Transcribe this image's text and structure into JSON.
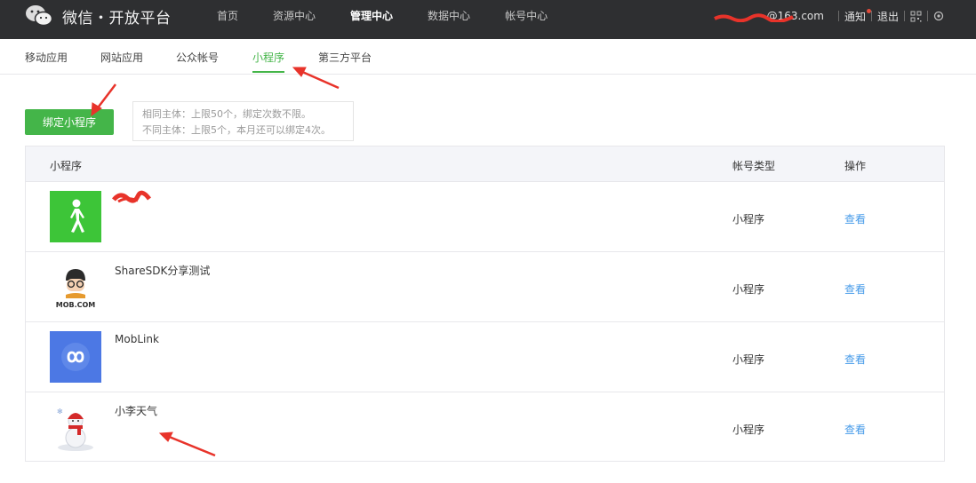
{
  "header": {
    "brand": "微信・开放平台",
    "nav": [
      {
        "label": "首页",
        "active": false
      },
      {
        "label": "资源中心",
        "active": false
      },
      {
        "label": "管理中心",
        "active": true
      },
      {
        "label": "数据中心",
        "active": false
      },
      {
        "label": "帐号中心",
        "active": false
      }
    ],
    "account_email_suffix": "@163.com",
    "notice": "通知",
    "logout": "退出"
  },
  "subtabs": [
    {
      "label": "移动应用",
      "active": false
    },
    {
      "label": "网站应用",
      "active": false
    },
    {
      "label": "公众帐号",
      "active": false
    },
    {
      "label": "小程序",
      "active": true
    },
    {
      "label": "第三方平台",
      "active": false
    }
  ],
  "bind_button": "绑定小程序",
  "tip": {
    "line1": "相同主体：上限50个，绑定次数不限。",
    "line2": "不同主体：上限5个，本月还可以绑定4次。"
  },
  "table": {
    "headers": {
      "name": "小程序",
      "type": "帐号类型",
      "action": "操作"
    },
    "rows": [
      {
        "name": "",
        "type": "小程序",
        "action": "查看",
        "icon": "walking-person-icon"
      },
      {
        "name": "ShareSDK分享测试",
        "type": "小程序",
        "action": "查看",
        "icon": "mob-logo-icon"
      },
      {
        "name": "MobLink",
        "type": "小程序",
        "action": "查看",
        "icon": "moblink-infinity-icon"
      },
      {
        "name": "小李天气",
        "type": "小程序",
        "action": "查看",
        "icon": "snowman-icon"
      }
    ]
  },
  "colors": {
    "accent": "#44b549",
    "link": "#459ae9",
    "topbar": "#2e2f31",
    "annotation": "#e8332a"
  }
}
